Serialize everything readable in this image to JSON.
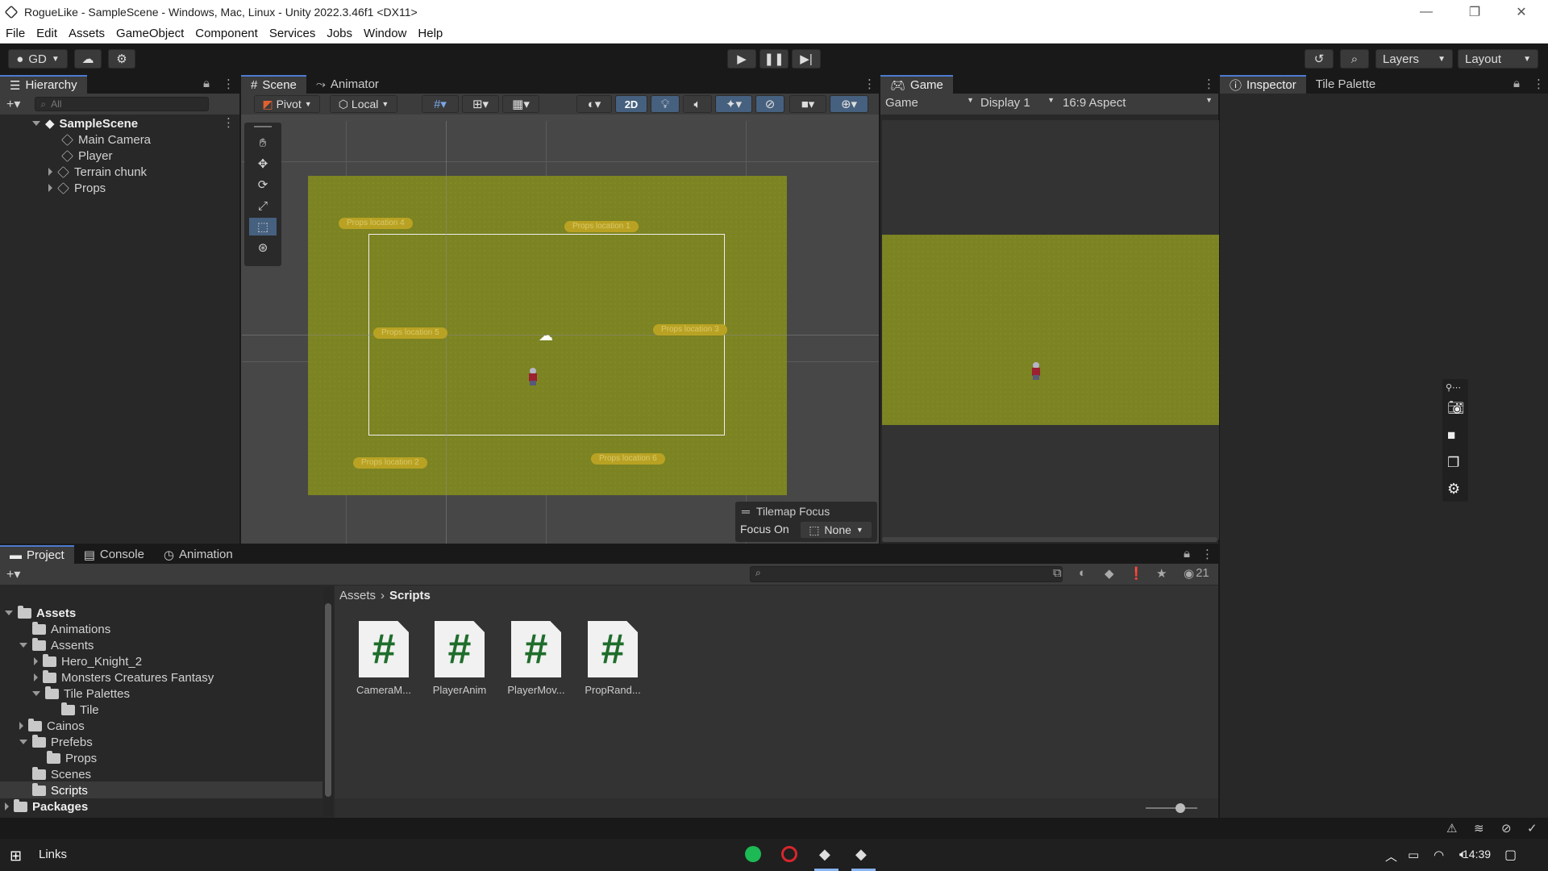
{
  "window": {
    "title": "RogueLike - SampleScene - Windows, Mac, Linux - Unity 2022.3.46f1 <DX11>"
  },
  "menu": [
    "File",
    "Edit",
    "Assets",
    "GameObject",
    "Component",
    "Services",
    "Jobs",
    "Window",
    "Help"
  ],
  "toolbar": {
    "account": "GD",
    "layers": "Layers",
    "layout": "Layout"
  },
  "hierarchy": {
    "tab": "Hierarchy",
    "search_placeholder": "All",
    "scene": "SampleScene",
    "items": [
      "Main Camera",
      "Player",
      "Terrain chunk",
      "Props"
    ]
  },
  "scene": {
    "tabs": [
      "Scene",
      "Animator"
    ],
    "pivot": "Pivot",
    "local": "Local",
    "mode_2d": "2D",
    "props": [
      "Props location 4",
      "Props location 1",
      "Props location 5",
      "Props location 3",
      "Props location 2",
      "Props location 6"
    ],
    "overlay_title": "Tilemap Focus",
    "focus_label": "Focus On",
    "focus_value": "None"
  },
  "game": {
    "tab": "Game",
    "mode": "Game",
    "display": "Display 1",
    "aspect": "16:9 Aspect"
  },
  "inspector": {
    "tabs": [
      "Inspector",
      "Tile Palette"
    ]
  },
  "project": {
    "tabs": [
      "Project",
      "Console",
      "Animation"
    ],
    "tree": [
      {
        "label": "Assets",
        "bold": true
      },
      {
        "label": "Animations"
      },
      {
        "label": "Assents"
      },
      {
        "label": "Hero_Knight_2"
      },
      {
        "label": "Monsters Creatures Fantasy"
      },
      {
        "label": "Tile Palettes"
      },
      {
        "label": "Tile"
      },
      {
        "label": "Cainos"
      },
      {
        "label": "Prefebs"
      },
      {
        "label": "Props"
      },
      {
        "label": "Scenes"
      },
      {
        "label": "Scripts"
      },
      {
        "label": "Packages",
        "bold": true
      }
    ],
    "breadcrumb": [
      "Assets",
      "Scripts"
    ],
    "hidden_count": "21",
    "files": [
      "CameraM...",
      "PlayerAnim",
      "PlayerMov...",
      "PropRand..."
    ]
  },
  "taskbar": {
    "links": "Links",
    "time": "14:39"
  },
  "colors": {
    "accent": "#4c7bd0",
    "grass": "#7c8322",
    "prop_label": "#b9a223"
  }
}
